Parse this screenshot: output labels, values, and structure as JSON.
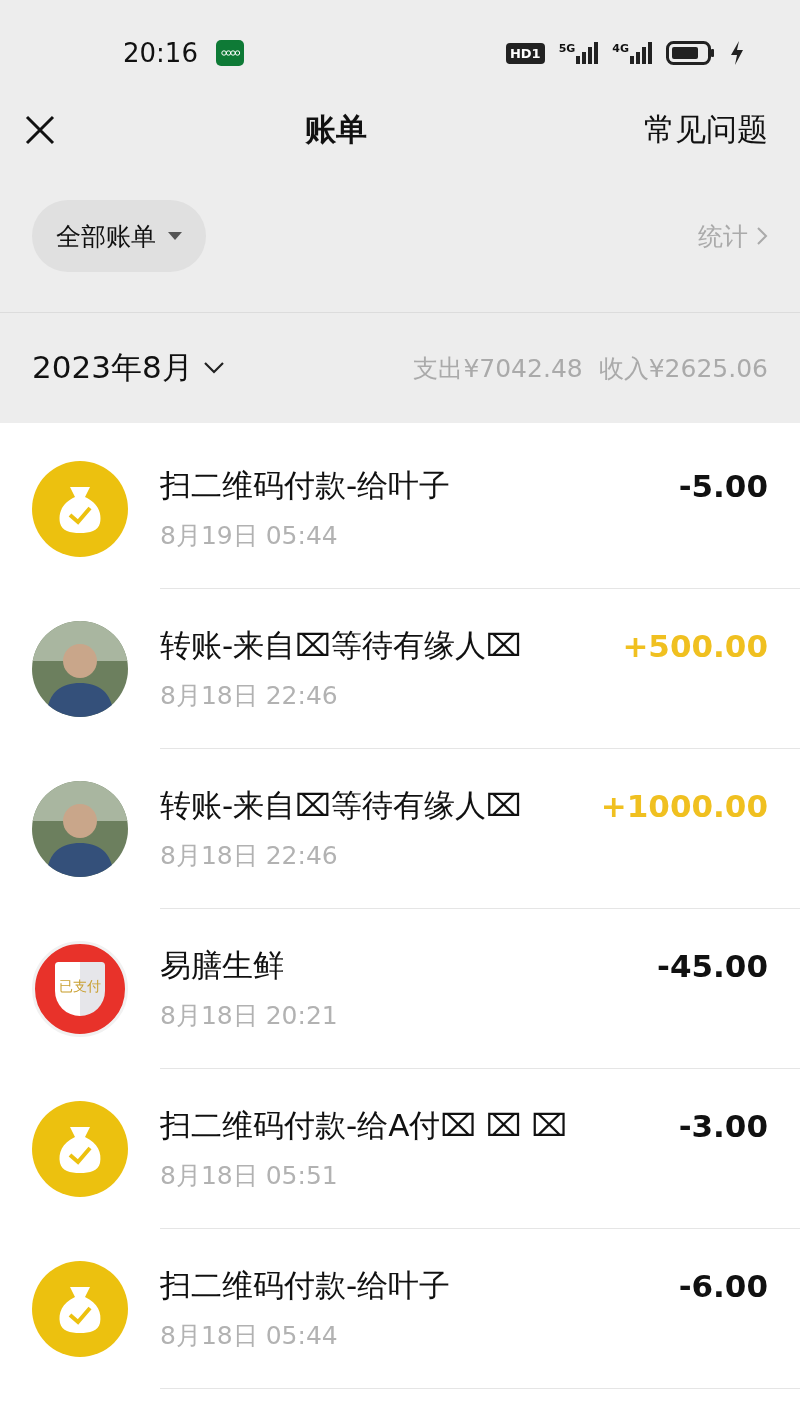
{
  "status_bar": {
    "time": "20:16",
    "hd_label": "HD1",
    "net_1": "5G",
    "net_2": "4G"
  },
  "nav": {
    "title": "账单",
    "right_link": "常见问题"
  },
  "filter": {
    "label": "全部账单",
    "stats_link": "统计"
  },
  "month": {
    "label": "2023年8月",
    "expense": "支出¥7042.48",
    "income": "收入¥2625.06"
  },
  "rows": [
    {
      "kind": "scan",
      "title": "扫二维码付款-给叶子",
      "time": "8月19日 05:44",
      "amount": "-5.00",
      "income": false
    },
    {
      "kind": "transfer",
      "title": "转账-来自⌧等待有缘人⌧",
      "time": "8月18日 22:46",
      "amount": "+500.00",
      "income": true
    },
    {
      "kind": "transfer",
      "title": "转账-来自⌧等待有缘人⌧",
      "time": "8月18日 22:46",
      "amount": "+1000.00",
      "income": true
    },
    {
      "kind": "merchant",
      "icon_text": "已支付",
      "title": "易膳生鲜",
      "time": "8月18日 20:21",
      "amount": "-45.00",
      "income": false
    },
    {
      "kind": "scan",
      "title": "扫二维码付款-给A付⌧ ⌧ ⌧",
      "time": "8月18日 05:51",
      "amount": "-3.00",
      "income": false
    },
    {
      "kind": "scan",
      "title": "扫二维码付款-给叶子",
      "time": "8月18日 05:44",
      "amount": "-6.00",
      "income": false
    }
  ]
}
